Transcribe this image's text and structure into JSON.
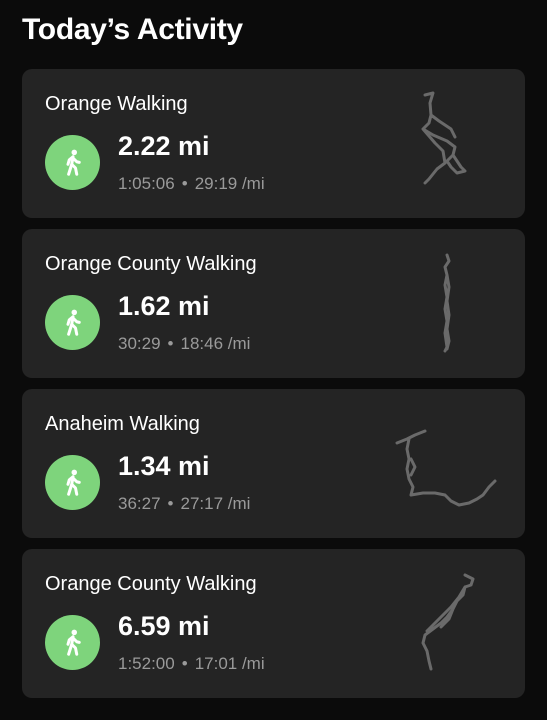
{
  "header": {
    "title": "Today’s Activity"
  },
  "colors": {
    "background": "#0b0b0b",
    "card": "#242424",
    "accent_green": "#7ed47c",
    "secondary_text": "#9a9a9a",
    "route_gray": "#6a6a6a"
  },
  "activities": [
    {
      "title": "Orange Walking",
      "distance": "2.22 mi",
      "duration": "1:05:06",
      "separator": "•",
      "pace": "29:19 /mi",
      "icon": "walking-person-icon"
    },
    {
      "title": "Orange County Walking",
      "distance": "1.62 mi",
      "duration": "30:29",
      "separator": "•",
      "pace": "18:46 /mi",
      "icon": "walking-person-icon"
    },
    {
      "title": "Anaheim Walking",
      "distance": "1.34 mi",
      "duration": "36:27",
      "separator": "•",
      "pace": "27:17 /mi",
      "icon": "walking-person-icon"
    },
    {
      "title": "Orange County Walking",
      "distance": "6.59 mi",
      "duration": "1:52:00",
      "separator": "•",
      "pace": "17:01 /mi",
      "icon": "walking-person-icon"
    }
  ]
}
